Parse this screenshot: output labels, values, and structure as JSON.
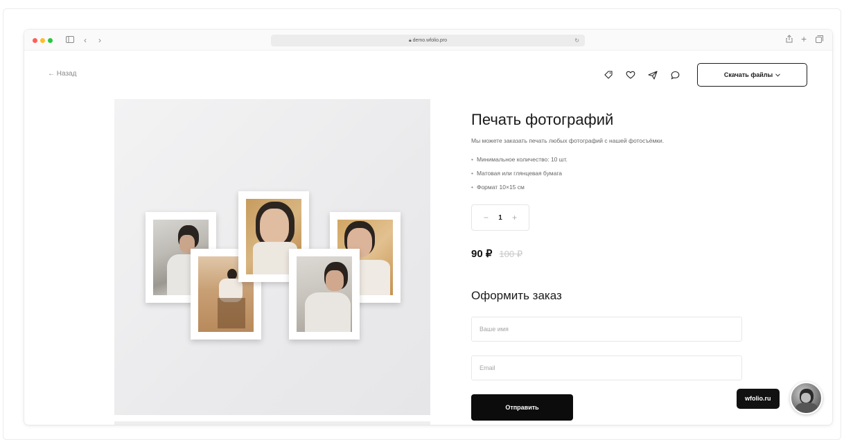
{
  "browser": {
    "url": "demo.wfolio.pro",
    "traffic_light_colors": [
      "#fe5f57",
      "#febc2e",
      "#28c840"
    ]
  },
  "nav": {
    "back_label": "← Назад",
    "download_label": "Скачать файлы",
    "icons": [
      "tag-icon",
      "heart-icon",
      "send-icon",
      "comment-icon"
    ]
  },
  "product": {
    "title": "Печать фотографий",
    "description": "Мы можете заказать печать любых фотографий с нашей фотосъёмки.",
    "features": [
      "Минимальное количество: 10 шт.",
      "Матовая или глянцевая бумага",
      "Формат 10×15 см"
    ],
    "quantity": "1",
    "minus_label": "−",
    "plus_label": "+",
    "price": "90 ₽",
    "old_price": "100 ₽"
  },
  "order": {
    "title": "Оформить заказ",
    "name_placeholder": "Ваше имя",
    "email_placeholder": "Email",
    "submit_label": "Отправить"
  },
  "widget": {
    "badge_label": "wfolio.ru"
  }
}
